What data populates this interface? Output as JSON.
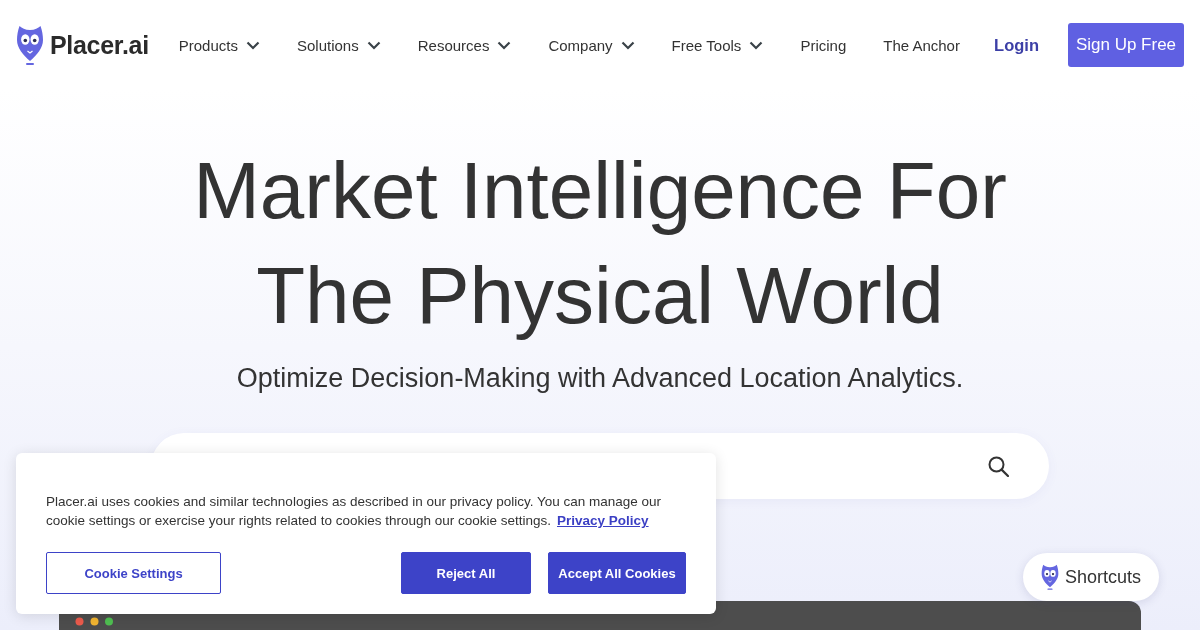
{
  "header": {
    "logo": "Placer.ai",
    "nav": [
      {
        "label": "Products",
        "has_menu": true
      },
      {
        "label": "Solutions",
        "has_menu": true
      },
      {
        "label": "Resources",
        "has_menu": true
      },
      {
        "label": "Company",
        "has_menu": true
      },
      {
        "label": "Free Tools",
        "has_menu": true
      },
      {
        "label": "Pricing",
        "has_menu": false
      },
      {
        "label": "The Anchor",
        "has_menu": false
      }
    ],
    "login": "Login",
    "signup": "Sign Up Free"
  },
  "hero": {
    "title": "Market Intelligence For The Physical World",
    "subtitle": "Optimize Decision-Making with Advanced Location Analytics."
  },
  "cookie_banner": {
    "text": "Placer.ai uses cookies and similar technologies as described in our privacy policy. You can manage our cookie settings or exercise your rights related to cookies through our cookie settings.",
    "link": "Privacy Policy",
    "buttons": [
      {
        "label": "Cookie Settings",
        "kind": "outline"
      },
      {
        "label": "Reject All",
        "kind": "solid"
      },
      {
        "label": "Accept All Cookies",
        "kind": "solid"
      }
    ]
  },
  "shortcuts": {
    "label": "Shortcuts"
  }
}
